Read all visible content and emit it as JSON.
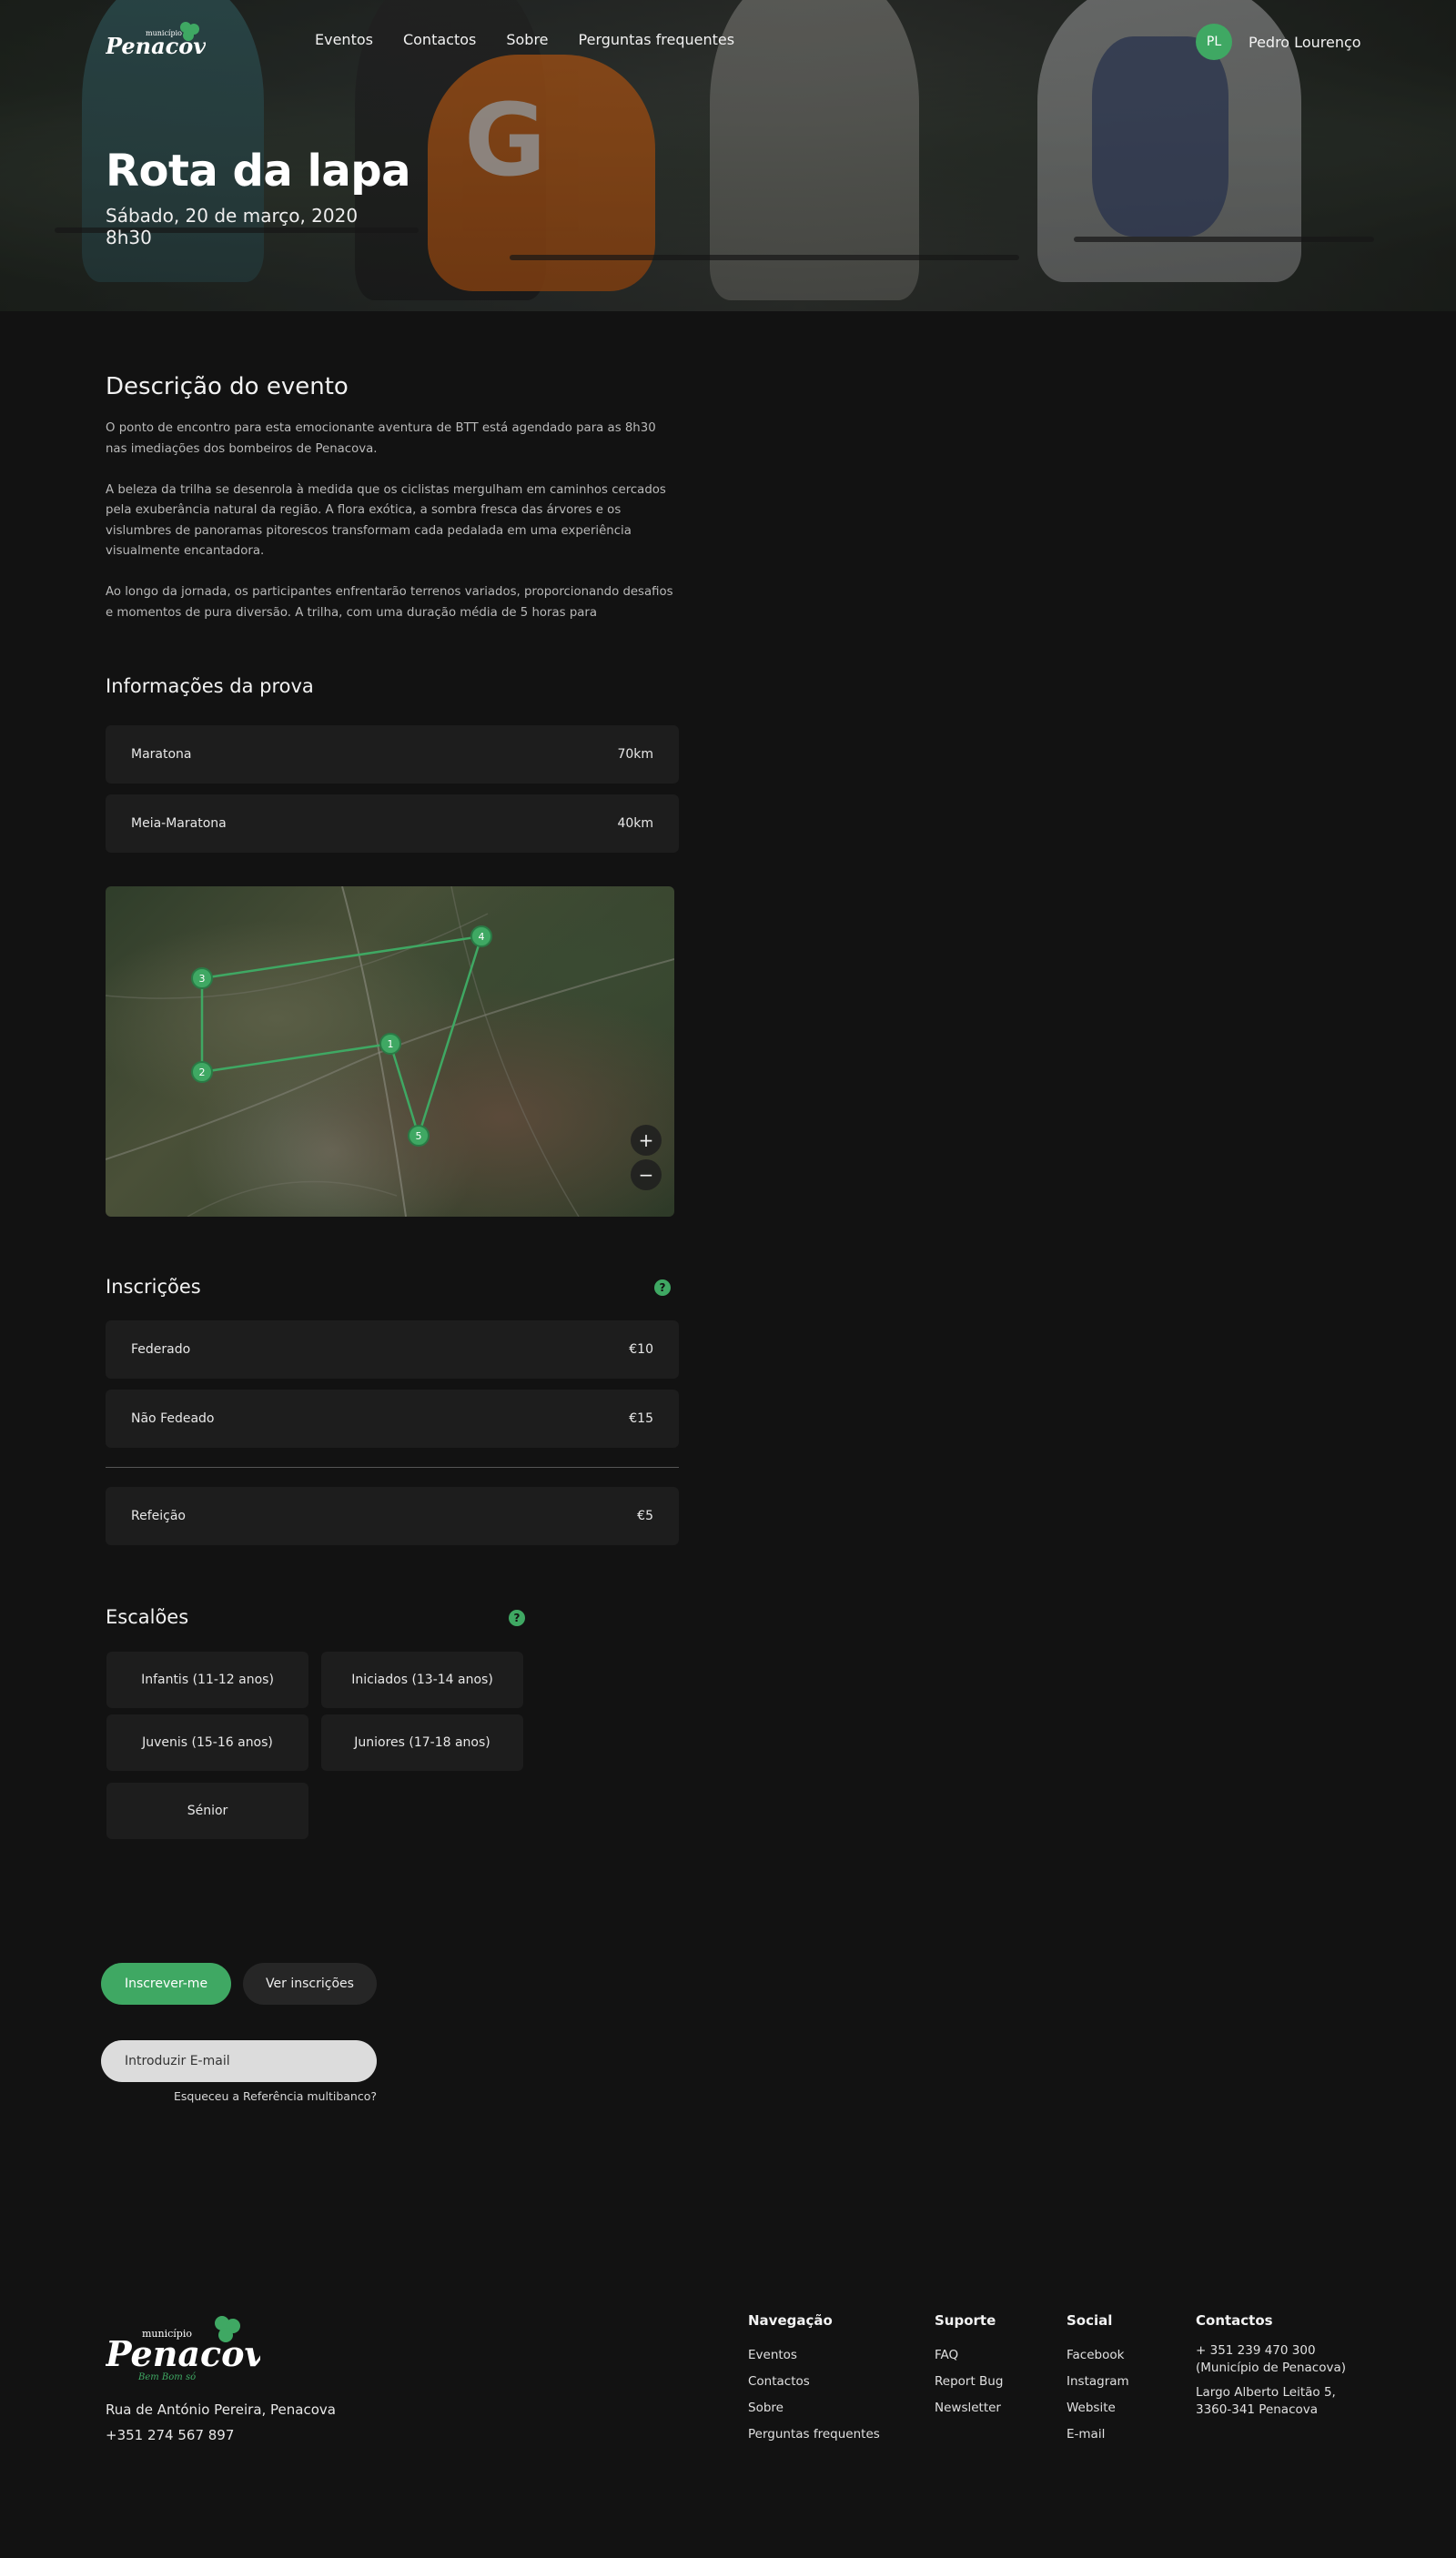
{
  "nav": {
    "logo_small": "município",
    "logo_main": "Penacova",
    "links": [
      "Eventos",
      "Contactos",
      "Sobre",
      "Perguntas frequentes"
    ],
    "user_initials": "PL",
    "user_name": "Pedro Lourenço"
  },
  "hero": {
    "title": "Rota da lapa",
    "date": "Sábado, 20 de março, 2020",
    "time": "8h30"
  },
  "description": {
    "title": "Descrição do evento",
    "paragraphs": [
      "O ponto de encontro para esta emocionante aventura de BTT está agendado para as 8h30 nas imediações dos bombeiros de Penacova.",
      "A beleza da trilha se desenrola à medida que os ciclistas mergulham em caminhos cercados pela exuberância natural da região. A flora exótica, a sombra fresca das árvores e os vislumbres de panoramas pitorescos transformam cada pedalada em uma experiência visualmente encantadora.",
      "Ao longo da jornada, os participantes enfrentarão terrenos variados, proporcionando desafios e momentos de pura diversão. A trilha, com uma duração média de 5 horas para"
    ]
  },
  "info": {
    "title": "Informações da prova",
    "rows": [
      {
        "label": "Maratona",
        "value": "70km"
      },
      {
        "label": "Meia-Maratona",
        "value": "40km"
      }
    ]
  },
  "map": {
    "waypoints": [
      "1",
      "2",
      "3",
      "4",
      "5"
    ],
    "zoom_in": "+",
    "zoom_out": "−",
    "route_color": "#3fa863"
  },
  "inscricoes": {
    "title": "Inscrições",
    "help": "?",
    "rows": [
      {
        "label": "Federado",
        "value": "€10"
      },
      {
        "label": "Não Fedeado",
        "value": "€15"
      }
    ],
    "extra": {
      "label": "Refeição",
      "value": "€5"
    }
  },
  "escaloes": {
    "title": "Escalões",
    "help": "?",
    "items": [
      "Infantis (11-12 anos)",
      "Iniciados (13-14 anos)",
      "Juvenis (15-16 anos)",
      "Juniores (17-18 anos)",
      "Sénior"
    ]
  },
  "actions": {
    "primary": "Inscrever-me",
    "secondary": "Ver inscrições",
    "email_placeholder": "Introduzir E-mail",
    "forgot": "Esqueceu a Referência multibanco?"
  },
  "footer": {
    "logo_small": "município",
    "logo_main": "Penacova",
    "logo_tag": "Bem Bom só",
    "address": "Rua de António Pereira, Penacova",
    "phone": "+351 274 567 897",
    "columns": [
      {
        "title": "Navegação",
        "items": [
          "Eventos",
          "Contactos",
          "Sobre",
          "Perguntas frequentes"
        ]
      },
      {
        "title": "Suporte",
        "items": [
          "FAQ",
          "Report Bug",
          "Newsletter"
        ]
      },
      {
        "title": "Social",
        "items": [
          "Facebook",
          "Instagram",
          "Website",
          "E-mail"
        ]
      }
    ],
    "contacts": {
      "title": "Contactos",
      "items": [
        "+ 351 239 470 300 (Município de Penacova)",
        "Largo Alberto Leitão 5, 3360-341 Penacova"
      ]
    }
  },
  "colors": {
    "accent": "#3fa863",
    "background": "#121212",
    "card": "#1d1d1d"
  }
}
